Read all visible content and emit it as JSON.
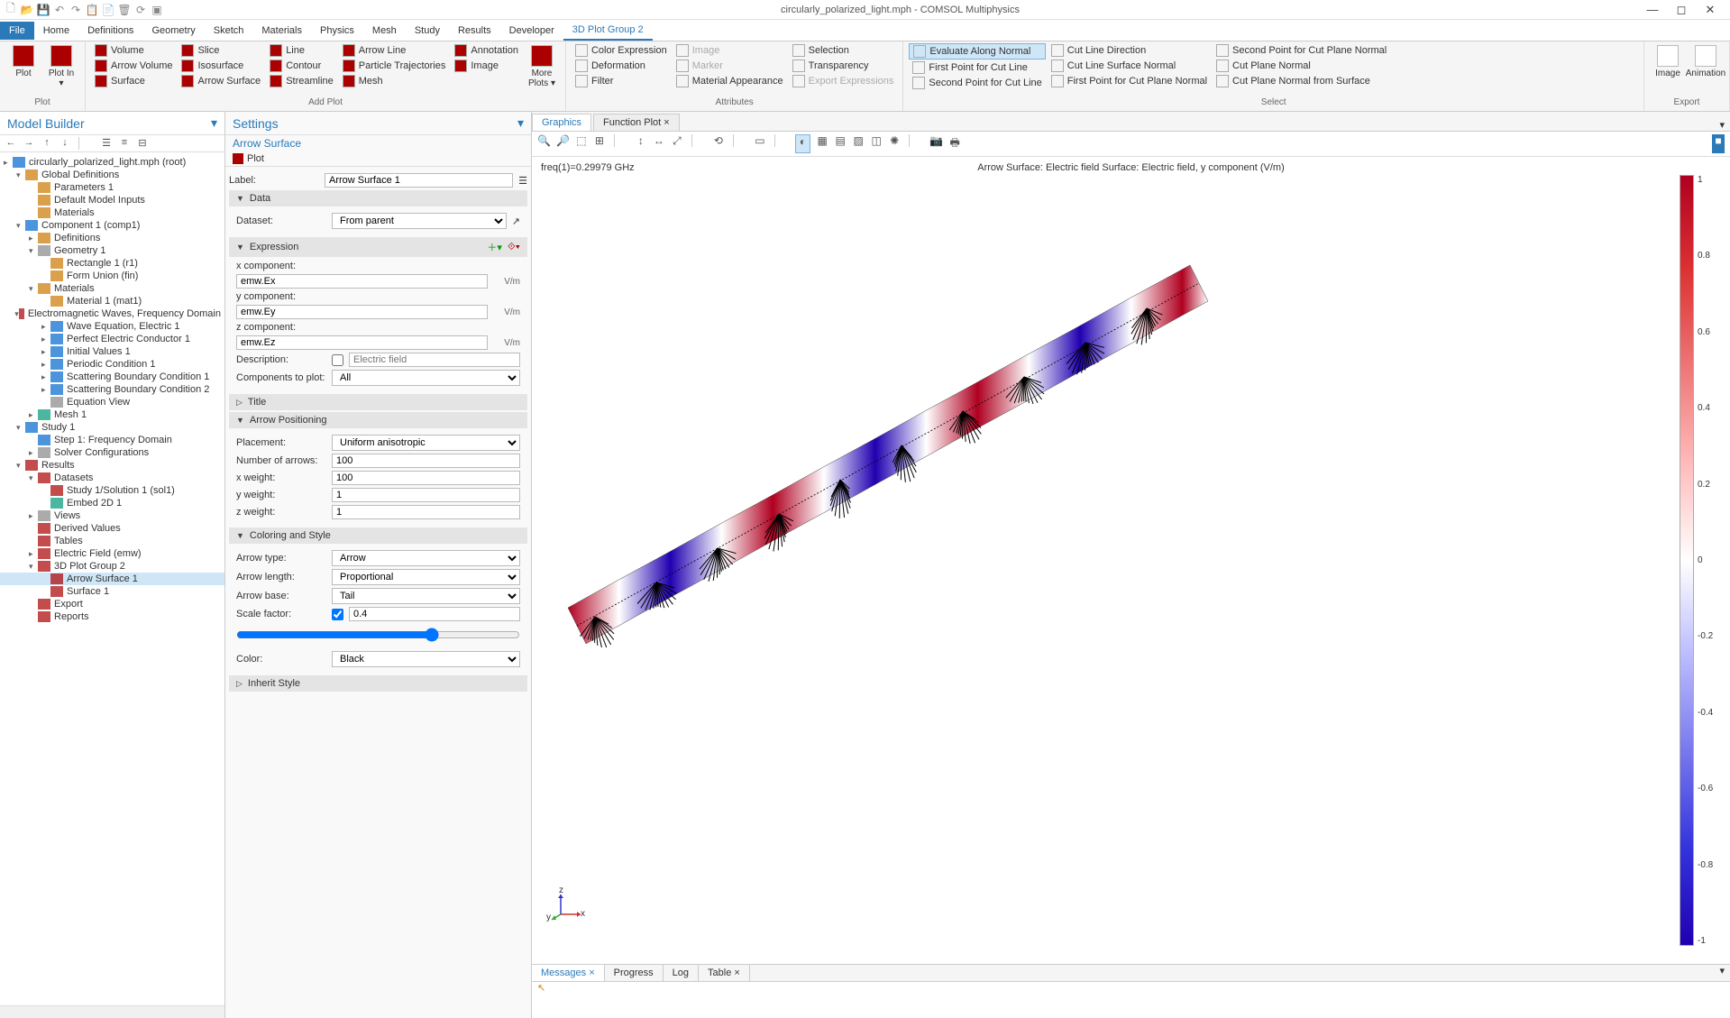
{
  "app": {
    "title": "circularly_polarized_light.mph - COMSOL Multiphysics"
  },
  "ribbon": {
    "tabs": [
      "File",
      "Home",
      "Definitions",
      "Geometry",
      "Sketch",
      "Materials",
      "Physics",
      "Mesh",
      "Study",
      "Results",
      "Developer",
      "3D Plot Group 2"
    ],
    "active_tab": "3D Plot Group 2",
    "groups": {
      "plot": {
        "label": "Plot",
        "big": [
          "Plot",
          "Plot In ▾"
        ]
      },
      "addplot": {
        "label": "Add Plot",
        "cols": [
          [
            "Volume",
            "Arrow Volume",
            "Surface"
          ],
          [
            "Slice",
            "Isosurface",
            "Arrow Surface"
          ],
          [
            "Line",
            "Contour",
            "Streamline"
          ],
          [
            "Arrow Line",
            "Particle Trajectories",
            "Mesh"
          ],
          [
            "Annotation",
            "Image"
          ]
        ],
        "more": "More Plots ▾"
      },
      "attributes": {
        "label": "Attributes",
        "cols": [
          [
            "Color Expression",
            "Deformation",
            "Filter"
          ],
          [
            "Image",
            "Marker",
            "Material Appearance"
          ],
          [
            "Selection",
            "Transparency",
            "Export Expressions"
          ]
        ]
      },
      "select": {
        "label": "Select",
        "cols": [
          [
            "Evaluate Along Normal",
            "First Point for Cut Line",
            "Second Point for Cut Line"
          ],
          [
            "Cut Line Direction",
            "Cut Line Surface Normal",
            "First Point for Cut Plane Normal"
          ],
          [
            "Second Point for Cut Plane Normal",
            "Cut Plane Normal",
            "Cut Plane Normal from Surface"
          ]
        ],
        "highlighted": "Evaluate Along Normal"
      },
      "export": {
        "label": "Export",
        "big": [
          "Image",
          "Animation"
        ]
      }
    }
  },
  "model_builder": {
    "title": "Model Builder",
    "tree": [
      {
        "d": 0,
        "a": "▸",
        "t": "circularly_polarized_light.mph (root)",
        "c": "#0066cc"
      },
      {
        "d": 1,
        "a": "▾",
        "t": "Global Definitions",
        "c": "#cc7700"
      },
      {
        "d": 2,
        "a": "",
        "t": "Parameters 1",
        "c": "#cc7700"
      },
      {
        "d": 2,
        "a": "",
        "t": "Default Model Inputs",
        "c": "#cc7700"
      },
      {
        "d": 2,
        "a": "",
        "t": "Materials",
        "c": "#cc7700"
      },
      {
        "d": 1,
        "a": "▾",
        "t": "Component 1 (comp1)",
        "c": "#0066cc"
      },
      {
        "d": 2,
        "a": "▸",
        "t": "Definitions",
        "c": "#cc7700"
      },
      {
        "d": 2,
        "a": "▾",
        "t": "Geometry 1",
        "c": "#888"
      },
      {
        "d": 3,
        "a": "",
        "t": "Rectangle 1 (r1)",
        "c": "#cc7700"
      },
      {
        "d": 3,
        "a": "",
        "t": "Form Union (fin)",
        "c": "#cc7700"
      },
      {
        "d": 2,
        "a": "▾",
        "t": "Materials",
        "c": "#cc7700"
      },
      {
        "d": 3,
        "a": "",
        "t": "Material 1 (mat1)",
        "c": "#cc7700"
      },
      {
        "d": 2,
        "a": "▾",
        "t": "Electromagnetic Waves, Frequency Domain",
        "c": "#aa0000"
      },
      {
        "d": 3,
        "a": "▸",
        "t": "Wave Equation, Electric 1",
        "c": "#0066cc"
      },
      {
        "d": 3,
        "a": "▸",
        "t": "Perfect Electric Conductor 1",
        "c": "#0066cc"
      },
      {
        "d": 3,
        "a": "▸",
        "t": "Initial Values 1",
        "c": "#0066cc"
      },
      {
        "d": 3,
        "a": "▸",
        "t": "Periodic Condition 1",
        "c": "#0066cc"
      },
      {
        "d": 3,
        "a": "▸",
        "t": "Scattering Boundary Condition 1",
        "c": "#0066cc"
      },
      {
        "d": 3,
        "a": "▸",
        "t": "Scattering Boundary Condition 2",
        "c": "#0066cc"
      },
      {
        "d": 3,
        "a": "",
        "t": "Equation View",
        "c": "#888"
      },
      {
        "d": 2,
        "a": "▸",
        "t": "Mesh 1",
        "c": "#009977"
      },
      {
        "d": 1,
        "a": "▾",
        "t": "Study 1",
        "c": "#0066cc"
      },
      {
        "d": 2,
        "a": "",
        "t": "Step 1: Frequency Domain",
        "c": "#0066cc"
      },
      {
        "d": 2,
        "a": "▸",
        "t": "Solver Configurations",
        "c": "#888"
      },
      {
        "d": 1,
        "a": "▾",
        "t": "Results",
        "c": "#aa0000"
      },
      {
        "d": 2,
        "a": "▾",
        "t": "Datasets",
        "c": "#aa0000"
      },
      {
        "d": 3,
        "a": "",
        "t": "Study 1/Solution 1 (sol1)",
        "c": "#aa0000"
      },
      {
        "d": 3,
        "a": "",
        "t": "Embed 2D 1",
        "c": "#009977"
      },
      {
        "d": 2,
        "a": "▸",
        "t": "Views",
        "c": "#888"
      },
      {
        "d": 2,
        "a": "",
        "t": "Derived Values",
        "c": "#aa0000"
      },
      {
        "d": 2,
        "a": "",
        "t": "Tables",
        "c": "#aa0000"
      },
      {
        "d": 2,
        "a": "▸",
        "t": "Electric Field (emw)",
        "c": "#aa0000"
      },
      {
        "d": 2,
        "a": "▾",
        "t": "3D Plot Group 2",
        "c": "#aa0000"
      },
      {
        "d": 3,
        "a": "",
        "t": "Arrow Surface 1",
        "c": "#aa0000",
        "sel": true
      },
      {
        "d": 3,
        "a": "",
        "t": "Surface 1",
        "c": "#aa0000"
      },
      {
        "d": 2,
        "a": "",
        "t": "Export",
        "c": "#aa0000"
      },
      {
        "d": 2,
        "a": "",
        "t": "Reports",
        "c": "#aa0000"
      }
    ]
  },
  "settings": {
    "title": "Settings",
    "subtitle": "Arrow Surface",
    "plot_btn": "Plot",
    "label_label": "Label:",
    "label_value": "Arrow Surface 1",
    "data": {
      "header": "Data",
      "dataset_label": "Dataset:",
      "dataset_value": "From parent"
    },
    "expression": {
      "header": "Expression",
      "xcomp_label": "x component:",
      "xcomp": "emw.Ex",
      "xunit": "V/m",
      "ycomp_label": "y component:",
      "ycomp": "emw.Ey",
      "yunit": "V/m",
      "zcomp_label": "z component:",
      "zcomp": "emw.Ez",
      "zunit": "V/m",
      "desc_label": "Description:",
      "desc_ph": "Electric field",
      "cplot_label": "Components to plot:",
      "cplot": "All"
    },
    "title_sect": "Title",
    "positioning": {
      "header": "Arrow Positioning",
      "placement_label": "Placement:",
      "placement": "Uniform anisotropic",
      "narrows_label": "Number of arrows:",
      "narrows": "100",
      "xw_label": "x weight:",
      "xw": "100",
      "yw_label": "y weight:",
      "yw": "1",
      "zw_label": "z weight:",
      "zw": "1"
    },
    "coloring": {
      "header": "Coloring and Style",
      "atype_label": "Arrow type:",
      "atype": "Arrow",
      "alen_label": "Arrow length:",
      "alen": "Proportional",
      "abase_label": "Arrow base:",
      "abase": "Tail",
      "scale_label": "Scale factor:",
      "scale": "0.4",
      "color_label": "Color:",
      "color": "Black"
    },
    "inherit": "Inherit Style"
  },
  "graphics": {
    "tabs": [
      "Graphics",
      "Function Plot"
    ],
    "active": "Graphics",
    "freq": "freq(1)=0.29979 GHz",
    "title": "Arrow Surface: Electric field   Surface: Electric field, y component (V/m)",
    "legend_ticks": [
      "1",
      "0.8",
      "0.6",
      "0.4",
      "0.2",
      "0",
      "-0.2",
      "-0.4",
      "-0.6",
      "-0.8",
      "-1"
    ],
    "axes": {
      "x": "x",
      "y": "y",
      "z": "z"
    }
  },
  "messages": {
    "tabs": [
      "Messages",
      "Progress",
      "Log",
      "Table"
    ],
    "active": "Messages"
  },
  "chart_data": {
    "type": "colorbar",
    "title": "Electric field, y component (V/m)",
    "range": [
      -1,
      1
    ],
    "ticks": [
      1,
      0.8,
      0.6,
      0.4,
      0.2,
      0,
      -0.2,
      -0.4,
      -0.6,
      -0.8,
      -1
    ],
    "colormap": "red-white-blue"
  }
}
